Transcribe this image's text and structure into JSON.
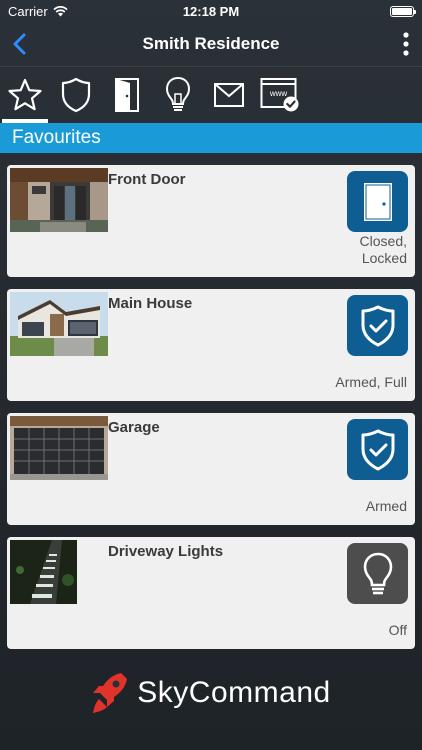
{
  "status": {
    "carrier": "Carrier",
    "time": "12:18 PM"
  },
  "nav": {
    "title": "Smith Residence"
  },
  "tabs": [
    {
      "icon": "star-icon"
    },
    {
      "icon": "shield-icon"
    },
    {
      "icon": "door-icon"
    },
    {
      "icon": "lightbulb-icon"
    },
    {
      "icon": "mail-icon"
    },
    {
      "icon": "www-icon",
      "label": "www"
    }
  ],
  "section": {
    "title": "Favourites"
  },
  "cards": [
    {
      "title": "Front Door",
      "status": "Closed,\nLocked",
      "icon": "door-icon"
    },
    {
      "title": "Main House",
      "status": "Armed, Full",
      "icon": "shield-check-icon"
    },
    {
      "title": "Garage",
      "status": "Armed",
      "icon": "shield-check-icon"
    },
    {
      "title": "Driveway Lights",
      "status": "Off",
      "icon": "lightbulb-icon"
    }
  ],
  "footer": {
    "brand": "SkyCommand"
  },
  "colors": {
    "accent": "#1a9bd7",
    "icon_bg": "#0e5e93",
    "icon_off_bg": "#4d4d4d",
    "back": "#2f8cff"
  }
}
